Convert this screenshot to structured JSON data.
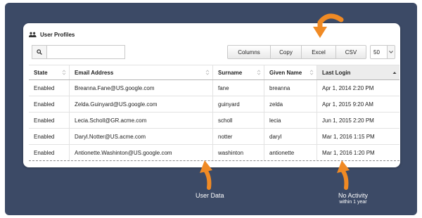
{
  "panel": {
    "title": "User Profiles",
    "icon": "users-icon"
  },
  "search": {
    "value": "",
    "placeholder": "",
    "icon": "search-icon"
  },
  "toolbar": {
    "buttons": [
      "Columns",
      "Copy",
      "Excel",
      "CSV"
    ],
    "page_size": "50"
  },
  "table": {
    "columns": [
      "State",
      "Email Address",
      "Surname",
      "Given Name",
      "Last Login"
    ],
    "sorted_column": "Last Login",
    "rows": [
      [
        "Enabled",
        "Breanna.Fane@US.google.com",
        "fane",
        "breanna",
        "Apr 1, 2014 2:20 PM"
      ],
      [
        "Enabled",
        "Zelda.Guinyard@US.google.com",
        "guinyard",
        "zelda",
        "Apr 1, 2015 9:20 AM"
      ],
      [
        "Enabled",
        "Lecia.Scholl@GR.acme.com",
        "scholl",
        "lecia",
        "Jun 1, 2015 2:20 PM"
      ],
      [
        "Enabled",
        "Daryl.Notter@US.acme.com",
        "notter",
        "daryl",
        "Mar 1, 2016 1:15 PM"
      ],
      [
        "Enabled",
        "Antionette.Washinton@US.google.com",
        "washinton",
        "antionette",
        "Mar 1, 2016 1:20 PM"
      ]
    ]
  },
  "callouts": {
    "user_data": "User Data",
    "no_activity": "No Activity",
    "no_activity_sub": "within 1 year"
  },
  "colors": {
    "background": "#3c4a66",
    "arrow": "#f08a24"
  }
}
